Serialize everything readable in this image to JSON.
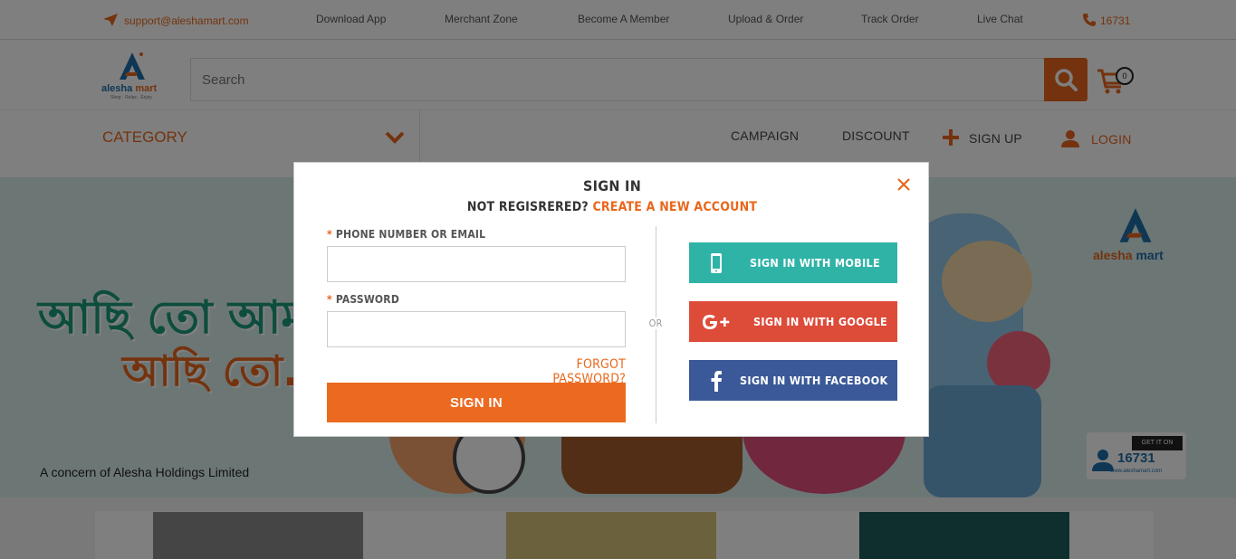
{
  "topbar": {
    "email": "support@aleshamart.com",
    "items": [
      "Download App",
      "Merchant Zone",
      "Become A Member",
      "Upload & Order",
      "Track Order",
      "Live Chat"
    ],
    "hotline": "16731"
  },
  "header": {
    "logo_brand": "alesha",
    "logo_mart": "mart",
    "logo_tagline": "Shop · Relax · Enjoy",
    "search_placeholder": "Search",
    "cart_count": "0"
  },
  "nav": {
    "category": "CATEGORY",
    "items": [
      "CAMPAIGN",
      "DISCOUNT"
    ],
    "signup": "SIGN UP",
    "login": "LOGIN"
  },
  "banner": {
    "headline1": "আছি তো আমরা",
    "headline2": "আছি তো...",
    "concern": "A concern of Alesha Holdings Limited",
    "logo_brand": "alesha",
    "logo_mart": "mart",
    "googleplay": "GET IT ON Google Play",
    "hotline": "16731",
    "url": "www.aleshamart.com"
  },
  "modal": {
    "title": "SIGN IN",
    "not_registered": "NOT REGISRERED?",
    "create_account": "CREATE A NEW ACCOUNT",
    "phone_label": "PHONE NUMBER OR EMAIL",
    "password_label": "PASSWORD",
    "phone_value": "",
    "password_value": "",
    "forgot": "FORGOT PASSWORD?",
    "signin_button": "SIGN IN",
    "or": "OR",
    "mobile": "SIGN IN WITH MOBILE",
    "google": "SIGN IN WITH GOOGLE",
    "facebook": "SIGN IN WITH FACEBOOK"
  },
  "colors": {
    "accent": "#e8671c",
    "mobile": "#2fb3a7",
    "google": "#dd4b39",
    "facebook": "#3b5998"
  }
}
